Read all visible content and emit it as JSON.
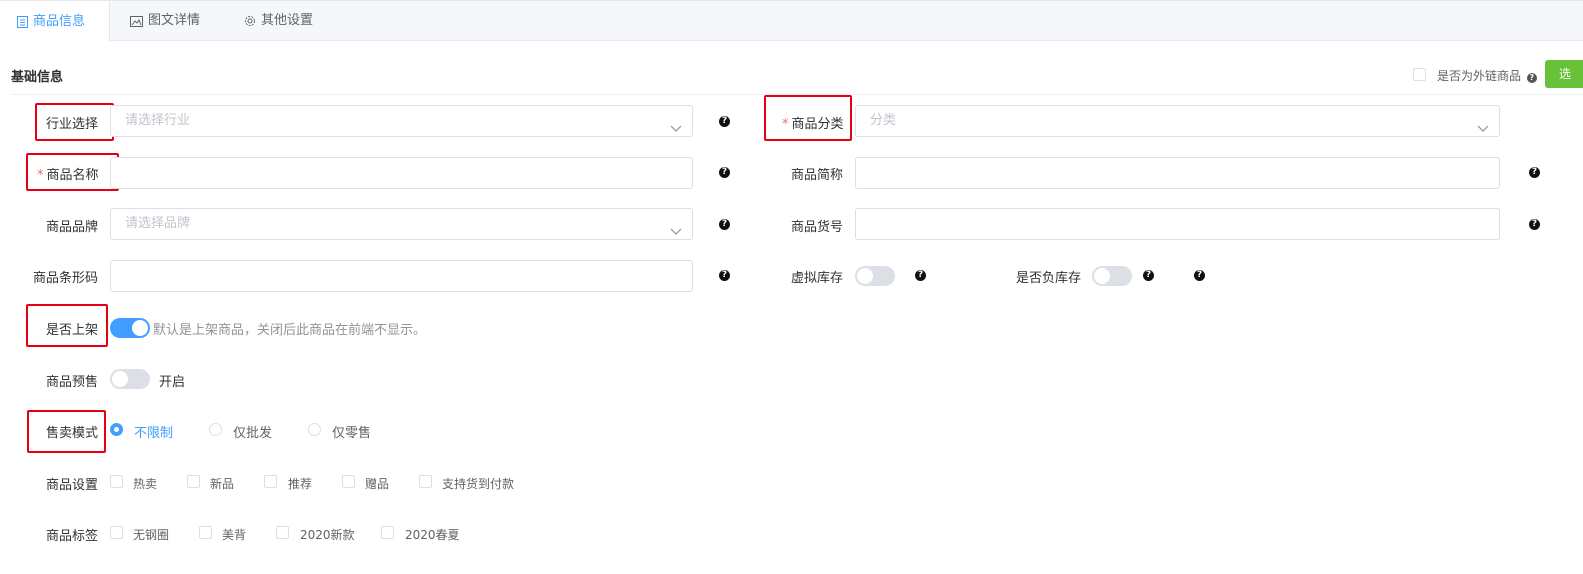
{
  "tabs": [
    {
      "label": "商品信息",
      "icon": "document-icon",
      "active": true
    },
    {
      "label": "图文详情",
      "icon": "image-icon",
      "active": false
    },
    {
      "label": "其他设置",
      "icon": "gear-icon",
      "active": false
    }
  ],
  "section": {
    "title": "基础信息",
    "external_label": "是否为外链商品",
    "green_button_label": "选"
  },
  "fields": {
    "industry": {
      "label": "行业选择",
      "placeholder": "请选择行业"
    },
    "category": {
      "label": "商品分类",
      "placeholder": "分类",
      "required": "*"
    },
    "name": {
      "label": "商品名称",
      "required": "*",
      "value": ""
    },
    "short_name": {
      "label": "商品简称",
      "value": ""
    },
    "brand": {
      "label": "商品品牌",
      "placeholder": "请选择品牌"
    },
    "sku": {
      "label": "商品货号",
      "value": ""
    },
    "barcode": {
      "label": "商品条形码",
      "value": ""
    },
    "virtual_stock": {
      "label": "虚拟库存",
      "on": false
    },
    "negative_stock": {
      "label": "是否负库存",
      "on": false
    },
    "on_shelf": {
      "label": "是否上架",
      "on": true,
      "hint": "默认是上架商品，关闭后此商品在前端不显示。"
    },
    "presale": {
      "label": "商品预售",
      "on": false,
      "text": "开启"
    },
    "sale_mode": {
      "label": "售卖模式",
      "options": [
        "不限制",
        "仅批发",
        "仅零售"
      ],
      "selected": "不限制"
    },
    "settings": {
      "label": "商品设置",
      "options": [
        "热卖",
        "新品",
        "推荐",
        "赠品",
        "支持货到付款"
      ]
    },
    "tags": {
      "label": "商品标签",
      "options": [
        "无钢圈",
        "美背",
        "2020新款",
        "2020春夏"
      ]
    }
  },
  "help_icon": "?",
  "colors": {
    "accent": "#409eff",
    "required": "#f56c6c",
    "highlight": "#e60012",
    "green": "#67c23a"
  }
}
